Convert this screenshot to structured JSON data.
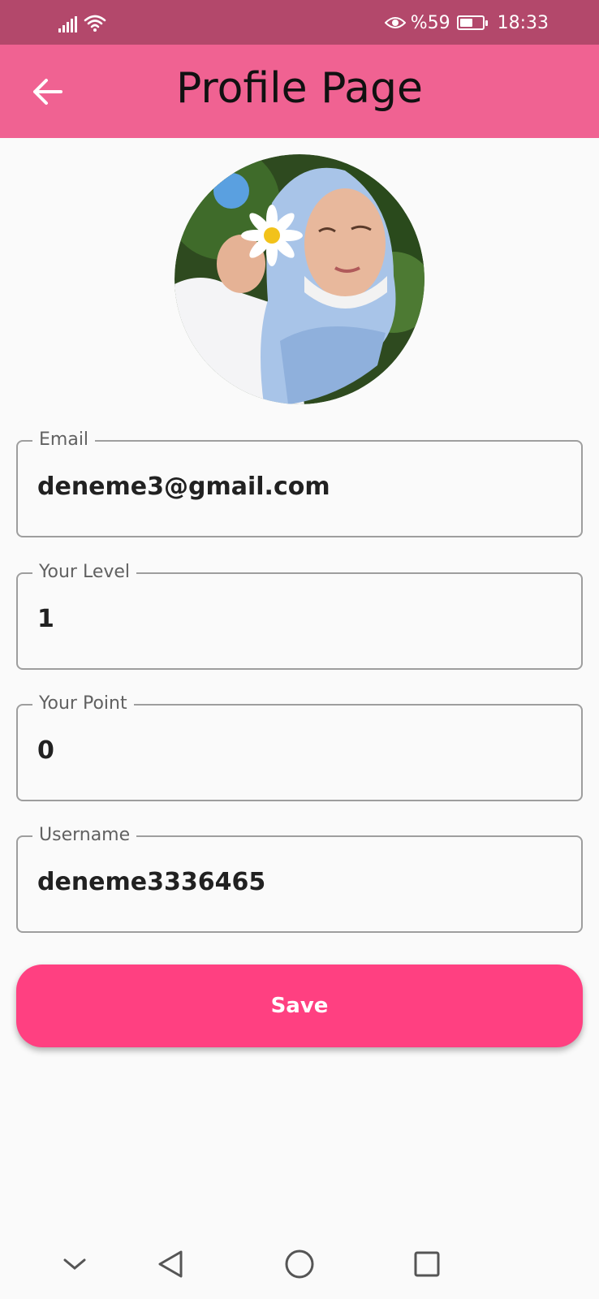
{
  "status_bar": {
    "battery": "%59",
    "battery_level": 0.59,
    "time": "18:33",
    "icons": [
      "signal-icon",
      "wifi-icon",
      "eye-comfort-icon",
      "battery-icon"
    ]
  },
  "app_bar": {
    "title": "Profile Page",
    "back_icon": "arrow-left-icon",
    "background": "#f06292"
  },
  "profile": {
    "avatar": "profile-photo"
  },
  "fields": [
    {
      "label": "Email",
      "value": "deneme3@gmail.com"
    },
    {
      "label": "Your Level",
      "value": "1"
    },
    {
      "label": "Your Point",
      "value": "0"
    },
    {
      "label": "Username",
      "value": "deneme3336465"
    }
  ],
  "actions": {
    "save_label": "Save",
    "save_color": "#ff4081"
  },
  "nav_bar": {
    "icons": [
      "chevron-down-icon",
      "back-triangle-icon",
      "home-circle-icon",
      "recents-square-icon"
    ]
  }
}
